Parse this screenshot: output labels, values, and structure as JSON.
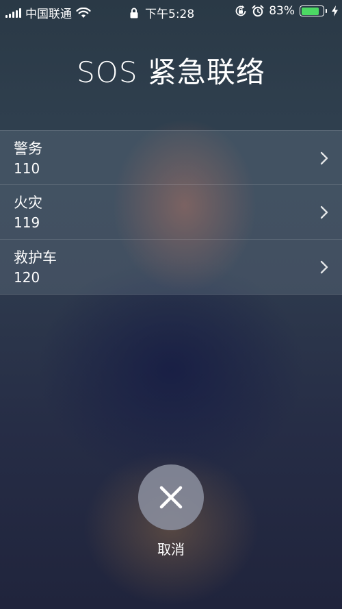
{
  "status_bar": {
    "carrier": "中国联通",
    "time": "下午5:28",
    "battery_percent_text": "83%",
    "battery_level": 0.83,
    "battery_color": "#4cd964",
    "icons": [
      "signal-icon",
      "wifi-icon",
      "lock-icon",
      "rotation-lock-icon",
      "alarm-icon",
      "charging-icon"
    ]
  },
  "title": "SOS 紧急联络",
  "contacts": [
    {
      "name": "警务",
      "number": "110"
    },
    {
      "name": "火灾",
      "number": "119"
    },
    {
      "name": "救护车",
      "number": "120"
    }
  ],
  "cancel": {
    "label": "取消",
    "icon": "close-icon"
  }
}
